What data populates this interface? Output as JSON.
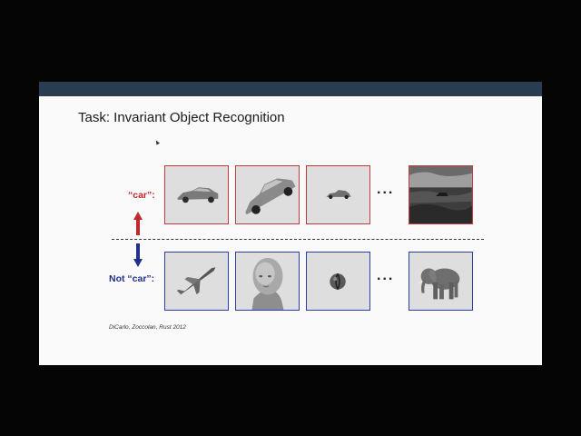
{
  "slide": {
    "title": "Task: Invariant Object Recognition",
    "positive_label": "“car”:",
    "negative_label": "Not “car”:",
    "ellipsis": "...",
    "citation": "DiCarlo, Zoccolan, Rust 2012"
  },
  "colors": {
    "positive": "#c0282e",
    "negative": "#23308a",
    "header_bar": "#283d4f"
  },
  "positive_examples": [
    {
      "name": "car-side-view-image"
    },
    {
      "name": "car-tilted-large-image"
    },
    {
      "name": "car-small-image"
    },
    {
      "name": "car-in-landscape-image"
    }
  ],
  "negative_examples": [
    {
      "name": "jet-plane-image"
    },
    {
      "name": "human-head-image"
    },
    {
      "name": "ball-image"
    },
    {
      "name": "elephant-image"
    }
  ]
}
